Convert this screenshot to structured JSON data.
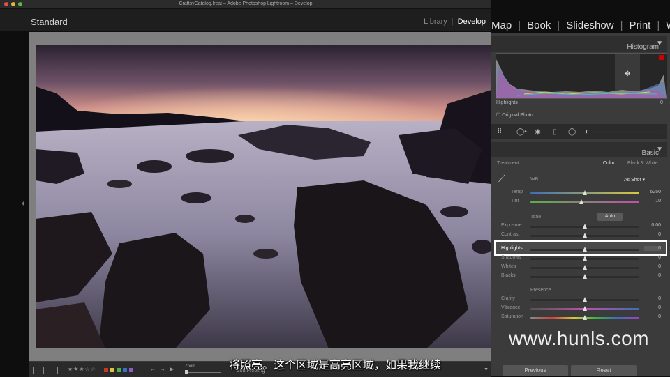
{
  "window": {
    "title": "CraftsyCatalog.lrcat – Adobe Photoshop Lightroom – Develop"
  },
  "header": {
    "catalog_label": "Standard",
    "modules": [
      {
        "label": "Library",
        "active": false
      },
      {
        "label": "Develop",
        "active": true
      }
    ],
    "modules_overflow": [
      "Map",
      "Book",
      "Slideshow",
      "Print",
      "We"
    ]
  },
  "histogram": {
    "title": "Histogram",
    "readout_label": "Highlights",
    "readout_value": "0",
    "original_photo": "Original Photo"
  },
  "basic": {
    "title": "Basic",
    "treatment_label": "Treatment :",
    "treatment_color": "Color",
    "treatment_bw": "Black & White",
    "wb_label": "WB :",
    "wb_value": "As Shot",
    "tone_label": "Tone",
    "auto_label": "Auto",
    "presence_label": "Presence",
    "sliders": {
      "temp": {
        "label": "Temp",
        "value": "6250",
        "position": 0.5
      },
      "tint": {
        "label": "Tint",
        "value": "– 10",
        "position": 0.47
      },
      "exposure": {
        "label": "Exposure",
        "value": "0.00",
        "position": 0.5
      },
      "contrast": {
        "label": "Contrast",
        "value": "0",
        "position": 0.5
      },
      "highlights": {
        "label": "Highlights",
        "value": "0",
        "position": 0.5
      },
      "shadows": {
        "label": "Shadows",
        "value": "0",
        "position": 0.5
      },
      "whites": {
        "label": "Whites",
        "value": "0",
        "position": 0.5
      },
      "blacks": {
        "label": "Blacks",
        "value": "0",
        "position": 0.5
      },
      "clarity": {
        "label": "Clarity",
        "value": "0",
        "position": 0.5
      },
      "vibrance": {
        "label": "Vibrance",
        "value": "0",
        "position": 0.5
      },
      "saturation": {
        "label": "Saturation",
        "value": "0",
        "position": 0.5
      }
    }
  },
  "footer_buttons": {
    "previous": "Previous",
    "reset": "Reset"
  },
  "toolbar": {
    "stars": "★★★☆☆",
    "zoom_label": "Zoom",
    "soft_proofing": "Soft Proofing"
  },
  "subtitle": "将照亮。这个区域是高亮区域，如果我继续",
  "watermark": "www.hunls.com",
  "colors": {
    "accent": "#ffffff",
    "panel": "#3b3b3b",
    "canvas": "#7f7f7f"
  }
}
